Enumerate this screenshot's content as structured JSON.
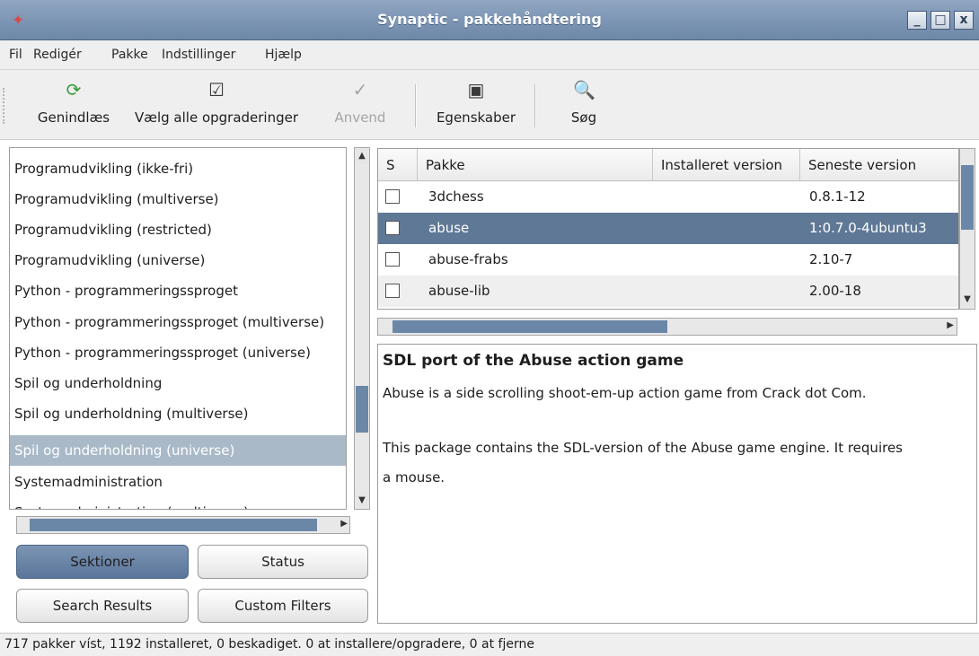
{
  "window": {
    "title": "Synaptic - pakkehåndtering"
  },
  "menubar": {
    "items": [
      "Fil",
      "Redigér",
      "Pakke",
      "Indstillinger",
      "Hjælp"
    ]
  },
  "toolbar": {
    "reload": "Genindlæs",
    "mark_all_upgrades": "Vælg alle opgraderinger",
    "apply": "Anvend",
    "properties": "Egenskaber",
    "search": "Søg"
  },
  "sections": {
    "items": [
      "Programudvikling (ikke-fri)",
      "Programudvikling (multiverse)",
      "Programudvikling (restricted)",
      "Programudvikling (universe)",
      "Python - programmeringssproget",
      "Python - programmeringssproget (multiverse)",
      "Python - programmeringssproget (universe)",
      "Spil og underholdning",
      "Spil og underholdning (multiverse)",
      "Spil og underholdning (universe)",
      "Systemadministration",
      "Systemadministration (multiverse)"
    ],
    "selected": "Spil og underholdning (universe)"
  },
  "filter_buttons": {
    "sections": "Sektioner",
    "status": "Status",
    "search_results": "Search Results",
    "custom_filters": "Custom Filters"
  },
  "package_table": {
    "headers": [
      "S",
      "Pakke",
      "Installeret version",
      "Seneste version"
    ],
    "rows": [
      {
        "name": "3dchess",
        "installed": "",
        "latest": "0.8.1-12"
      },
      {
        "name": "abuse",
        "installed": "",
        "latest": "1:0.7.0-4ubuntu3"
      },
      {
        "name": "abuse-frabs",
        "installed": "",
        "latest": "2.10-7"
      },
      {
        "name": "abuse-lib",
        "installed": "",
        "latest": "2.00-18"
      }
    ],
    "selected_row": "abuse"
  },
  "description": {
    "title": "SDL port of the Abuse action game",
    "line1": "Abuse is a side scrolling shoot-em-up action game from Crack dot Com.",
    "line2": "This package contains the SDL-version of the Abuse game engine. It requires",
    "line3": "a mouse."
  },
  "statusbar": {
    "text": "717 pakker víst, 1192 installeret, 0 beskadiget. 0 at installere/opgradere, 0 at fjerne"
  },
  "colors": {
    "title_bar": "#7a93b4",
    "selection": "#5f7896",
    "section_selection": "#a9b9c8"
  }
}
